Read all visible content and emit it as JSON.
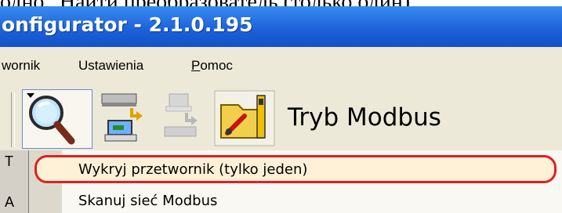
{
  "doc_caption": "одно „Найти преобразователь (только один)\".",
  "window": {
    "title": "onfigurator - 2.1.0.195"
  },
  "menu": {
    "items": [
      "wornik",
      "Ustawienia",
      "Pomoc"
    ]
  },
  "toolbar": {
    "mode_label": "Tryb Modbus"
  },
  "left_panel": {
    "letters": [
      "T",
      "A"
    ]
  },
  "dropdown": {
    "items": [
      "Wykryj przetwornik (tylko jeden)",
      "Skanuj sieć Modbus"
    ],
    "highlighted_index": 0
  },
  "colors": {
    "titlebar": "#1a5fd9",
    "highlight_border": "#e02020",
    "highlight_fill": "#fff1d8"
  }
}
